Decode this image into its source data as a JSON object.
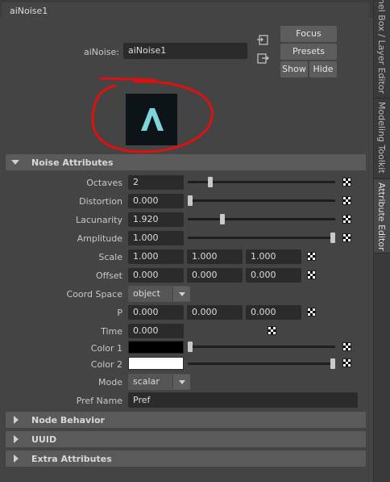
{
  "tab": {
    "label": "aiNoise1"
  },
  "header": {
    "node_label": "aiNoise:",
    "node_name": "aiNoise1",
    "focus_label": "Focus",
    "presets_label": "Presets",
    "show_label": "Show",
    "hide_label": "Hide",
    "swatch_letter": "A"
  },
  "sections": {
    "noise": "Noise Attributes",
    "node_behavior": "Node Behavior",
    "uuid": "UUID",
    "extra": "Extra Attributes"
  },
  "attrs": {
    "octaves": {
      "label": "Octaves",
      "value": "2",
      "slider_fraction": 0.12
    },
    "distortion": {
      "label": "Distortion",
      "value": "0.000",
      "slider_fraction": 0.0
    },
    "lacunarity": {
      "label": "Lacunarity",
      "value": "1.920",
      "slider_fraction": 0.24
    },
    "amplitude": {
      "label": "Amplitude",
      "value": "1.000",
      "slider_fraction": 1.0
    },
    "scale": {
      "label": "Scale",
      "values": [
        "1.000",
        "1.000",
        "1.000"
      ]
    },
    "offset": {
      "label": "Offset",
      "values": [
        "0.000",
        "0.000",
        "0.000"
      ]
    },
    "coord_space": {
      "label": "Coord Space",
      "value": "object"
    },
    "p": {
      "label": "P",
      "values": [
        "0.000",
        "0.000",
        "0.000"
      ]
    },
    "time": {
      "label": "Time",
      "value": "0.000"
    },
    "color1": {
      "label": "Color 1",
      "color": "#000000",
      "slider_fraction": 0.0
    },
    "color2": {
      "label": "Color 2",
      "color": "#ffffff",
      "slider_fraction": 1.0
    },
    "mode": {
      "label": "Mode",
      "value": "scalar"
    },
    "pref_name": {
      "label": "Pref Name",
      "value": "Pref"
    }
  },
  "sidebar_tabs": [
    "nel Box / Layer Editor",
    "Modeling Toolkit",
    "Attribute Editor"
  ],
  "colors": {
    "annotation_red": "#e01010",
    "swatch_bg": "#0d1418",
    "swatch_logo": "#7fd4dc"
  }
}
